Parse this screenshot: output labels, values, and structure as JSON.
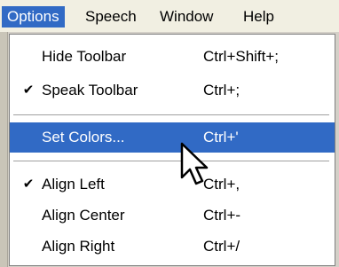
{
  "menubar": {
    "items": [
      {
        "label": "Options",
        "selected": true
      },
      {
        "label": "Speech"
      },
      {
        "label": "Window"
      },
      {
        "label": "Help"
      }
    ]
  },
  "menu": {
    "items": [
      {
        "label": "Hide Toolbar",
        "shortcut": "Ctrl+Shift+;",
        "checked": false
      },
      {
        "label": "Speak Toolbar",
        "shortcut": "Ctrl+;",
        "checked": true
      },
      {
        "label": "Set Colors...",
        "shortcut": "Ctrl+'",
        "highlighted": true
      },
      {
        "label": "Align Left",
        "shortcut": "Ctrl+,",
        "checked": true
      },
      {
        "label": "Align Center",
        "shortcut": "Ctrl+-",
        "checked": false
      },
      {
        "label": "Align Right",
        "shortcut": "Ctrl+/",
        "checked": false
      }
    ],
    "check_glyph": "✔"
  },
  "colors": {
    "highlight": "#316ac5",
    "menubar": "#f1efe2"
  },
  "icons": {
    "pointer": "mouse-pointer-arrow-icon"
  }
}
